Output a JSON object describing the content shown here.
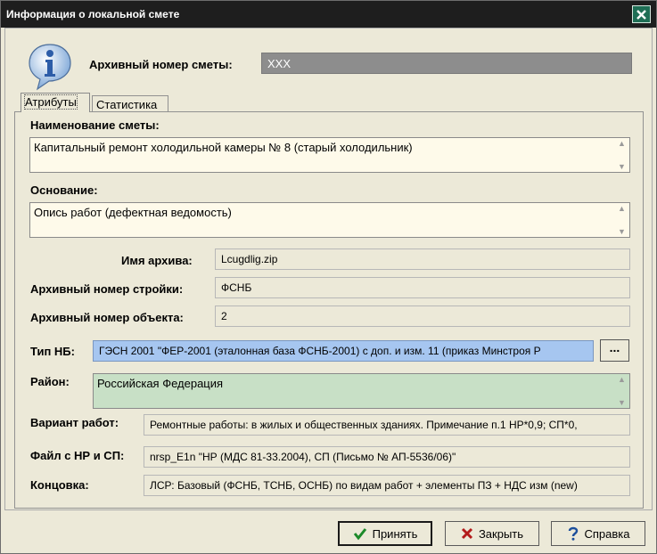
{
  "window": {
    "title": "Информация о локальной смете"
  },
  "header": {
    "archive_label": "Архивный номер сметы:",
    "archive_value": "XXX"
  },
  "tabs": [
    {
      "label": "Атрибуты"
    },
    {
      "label": "Статистика"
    }
  ],
  "attributes": {
    "name_label": "Наименование сметы:",
    "name_value": "Капитальный ремонт холодильной камеры № 8 (старый холодильник)",
    "basis_label": "Основание:",
    "basis_value": "Опись работ (дефектная ведомость)",
    "archive_name_label": "Имя архива:",
    "archive_name_value": "Lcugdlig.zip",
    "build_number_label": "Архивный номер стройки:",
    "build_number_value": "ФСНБ",
    "object_number_label": "Архивный номер объекта:",
    "object_number_value": "2",
    "nb_type_label": "Тип НБ:",
    "nb_type_value": "ГЭСН 2001 \"ФЕР-2001 (эталонная база ФСНБ-2001) с доп. и изм. 11 (приказ Минстроя Р",
    "nb_type_button": "...",
    "region_label": "Район:",
    "region_value": "Российская Федерация",
    "work_variant_label": "Вариант работ:",
    "work_variant_value": "Ремонтные работы: в жилых и общественных зданиях. Примечание п.1 НР*0,9; СП*0,",
    "np_file_label": "Файл с НР и СП:",
    "np_file_value": "nrsp_E1n \"НР (МДС 81-33.2004), СП (Письмо № АП-5536/06)\"",
    "ending_label": "Концовка:",
    "ending_value": "ЛСР: Базовый (ФСНБ, ТСНБ, ОСНБ) по видам работ + элементы ПЗ + НДС изм (new)"
  },
  "buttons": {
    "accept": "Принять",
    "close": "Закрыть",
    "help": "Справка"
  },
  "icons": [
    "info-icon",
    "close-icon",
    "check-icon",
    "x-icon",
    "help-icon",
    "scroll-up-icon",
    "scroll-down-icon"
  ]
}
